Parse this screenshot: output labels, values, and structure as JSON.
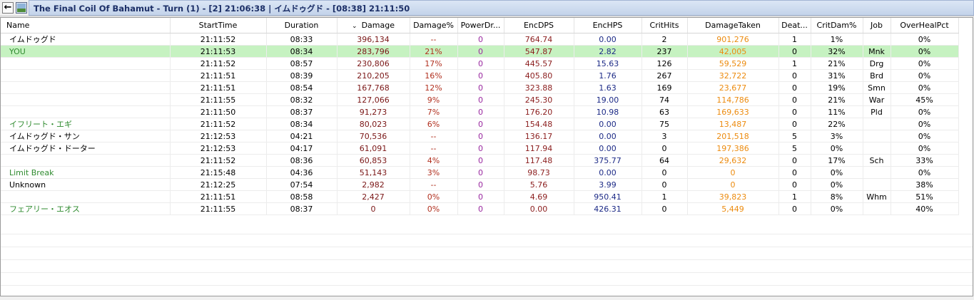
{
  "titlebar": {
    "back_icon": "back-arrow-icon",
    "encounter_icon": "encounter-image-icon",
    "title": "The Final Coil Of Bahamut - Turn (1) - [2] 21:06:38 | イムドゥグド - [08:38] 21:11:50"
  },
  "colors": {
    "selected_row": "#c6f2c1",
    "damage": "#7a1616",
    "damage_pct": "#b1301f",
    "power_drain": "#9a2aa0",
    "enc_dps": "#8b1d1d",
    "enc_hps": "#1c2a86",
    "damage_taken": "#ec8b0f",
    "pet_name": "#2f8b2f",
    "title_text": "#1c2f67"
  },
  "columns": {
    "name": "Name",
    "start_time": "StartTime",
    "duration": "Duration",
    "damage": "Damage",
    "damage_pct": "Damage%",
    "power_drain": "PowerDr...",
    "enc_dps": "EncDPS",
    "enc_hps": "EncHPS",
    "crit_hits": "CritHits",
    "damage_taken": "DamageTaken",
    "deaths": "Deat...",
    "crit_dam_pct": "CritDam%",
    "job": "Job",
    "over_heal_pct": "OverHealPct"
  },
  "rows": [
    {
      "name": "イムドゥグド",
      "start": "21:11:52",
      "duration": "08:33",
      "damage": "396,134",
      "damage_pct": "--",
      "power_drain": "0",
      "enc_dps": "764.74",
      "enc_hps": "0.00",
      "crit_hits": "2",
      "damage_taken": "901,276",
      "deaths": "1",
      "crit_dam": "1%",
      "job": "",
      "overheal": "0%"
    },
    {
      "name": "YOU",
      "start": "21:11:53",
      "duration": "08:34",
      "damage": "283,796",
      "damage_pct": "21%",
      "power_drain": "0",
      "enc_dps": "547.87",
      "enc_hps": "2.82",
      "crit_hits": "237",
      "damage_taken": "42,005",
      "deaths": "0",
      "crit_dam": "32%",
      "job": "Mnk",
      "overheal": "0%"
    },
    {
      "name": "",
      "start": "21:11:52",
      "duration": "08:57",
      "damage": "230,806",
      "damage_pct": "17%",
      "power_drain": "0",
      "enc_dps": "445.57",
      "enc_hps": "15.63",
      "crit_hits": "126",
      "damage_taken": "59,529",
      "deaths": "1",
      "crit_dam": "21%",
      "job": "Drg",
      "overheal": "0%"
    },
    {
      "name": "",
      "start": "21:11:51",
      "duration": "08:39",
      "damage": "210,205",
      "damage_pct": "16%",
      "power_drain": "0",
      "enc_dps": "405.80",
      "enc_hps": "1.76",
      "crit_hits": "267",
      "damage_taken": "32,722",
      "deaths": "0",
      "crit_dam": "31%",
      "job": "Brd",
      "overheal": "0%"
    },
    {
      "name": "",
      "start": "21:11:51",
      "duration": "08:54",
      "damage": "167,768",
      "damage_pct": "12%",
      "power_drain": "0",
      "enc_dps": "323.88",
      "enc_hps": "1.63",
      "crit_hits": "169",
      "damage_taken": "23,677",
      "deaths": "0",
      "crit_dam": "19%",
      "job": "Smn",
      "overheal": "0%"
    },
    {
      "name": "",
      "start": "21:11:55",
      "duration": "08:32",
      "damage": "127,066",
      "damage_pct": "9%",
      "power_drain": "0",
      "enc_dps": "245.30",
      "enc_hps": "19.00",
      "crit_hits": "74",
      "damage_taken": "114,786",
      "deaths": "0",
      "crit_dam": "21%",
      "job": "War",
      "overheal": "45%"
    },
    {
      "name": "",
      "start": "21:11:50",
      "duration": "08:37",
      "damage": "91,273",
      "damage_pct": "7%",
      "power_drain": "0",
      "enc_dps": "176.20",
      "enc_hps": "10.98",
      "crit_hits": "63",
      "damage_taken": "169,633",
      "deaths": "0",
      "crit_dam": "11%",
      "job": "Pld",
      "overheal": "0%"
    },
    {
      "name": "イフリート・エギ",
      "start": "21:11:52",
      "duration": "08:34",
      "damage": "80,023",
      "damage_pct": "6%",
      "power_drain": "0",
      "enc_dps": "154.48",
      "enc_hps": "0.00",
      "crit_hits": "75",
      "damage_taken": "13,487",
      "deaths": "0",
      "crit_dam": "22%",
      "job": "",
      "overheal": "0%"
    },
    {
      "name": "イムドゥグド・サン",
      "start": "21:12:53",
      "duration": "04:21",
      "damage": "70,536",
      "damage_pct": "--",
      "power_drain": "0",
      "enc_dps": "136.17",
      "enc_hps": "0.00",
      "crit_hits": "3",
      "damage_taken": "201,518",
      "deaths": "5",
      "crit_dam": "3%",
      "job": "",
      "overheal": "0%"
    },
    {
      "name": "イムドゥグド・ドーター",
      "start": "21:12:53",
      "duration": "04:17",
      "damage": "61,091",
      "damage_pct": "--",
      "power_drain": "0",
      "enc_dps": "117.94",
      "enc_hps": "0.00",
      "crit_hits": "0",
      "damage_taken": "197,386",
      "deaths": "5",
      "crit_dam": "0%",
      "job": "",
      "overheal": "0%"
    },
    {
      "name": "",
      "start": "21:11:52",
      "duration": "08:36",
      "damage": "60,853",
      "damage_pct": "4%",
      "power_drain": "0",
      "enc_dps": "117.48",
      "enc_hps": "375.77",
      "crit_hits": "64",
      "damage_taken": "29,632",
      "deaths": "0",
      "crit_dam": "17%",
      "job": "Sch",
      "overheal": "33%"
    },
    {
      "name": "Limit Break",
      "start": "21:15:48",
      "duration": "04:36",
      "damage": "51,143",
      "damage_pct": "3%",
      "power_drain": "0",
      "enc_dps": "98.73",
      "enc_hps": "0.00",
      "crit_hits": "0",
      "damage_taken": "0",
      "deaths": "0",
      "crit_dam": "0%",
      "job": "",
      "overheal": "0%"
    },
    {
      "name": "Unknown",
      "start": "21:12:25",
      "duration": "07:54",
      "damage": "2,982",
      "damage_pct": "--",
      "power_drain": "0",
      "enc_dps": "5.76",
      "enc_hps": "3.99",
      "crit_hits": "0",
      "damage_taken": "0",
      "deaths": "0",
      "crit_dam": "0%",
      "job": "",
      "overheal": "38%"
    },
    {
      "name": "",
      "start": "21:11:51",
      "duration": "08:58",
      "damage": "2,427",
      "damage_pct": "0%",
      "power_drain": "0",
      "enc_dps": "4.69",
      "enc_hps": "950.41",
      "crit_hits": "1",
      "damage_taken": "39,823",
      "deaths": "1",
      "crit_dam": "8%",
      "job": "Whm",
      "overheal": "51%"
    },
    {
      "name": "フェアリー・エオス",
      "start": "21:11:55",
      "duration": "08:37",
      "damage": "0",
      "damage_pct": "0%",
      "power_drain": "0",
      "enc_dps": "0.00",
      "enc_hps": "426.31",
      "crit_hits": "0",
      "damage_taken": "5,449",
      "deaths": "0",
      "crit_dam": "0%",
      "job": "",
      "overheal": "40%"
    }
  ],
  "row_styles": [
    "plain",
    "selected",
    "plain",
    "plain",
    "plain",
    "plain",
    "plain",
    "pet",
    "plain",
    "plain",
    "plain",
    "pet",
    "plain",
    "plain",
    "pet"
  ]
}
